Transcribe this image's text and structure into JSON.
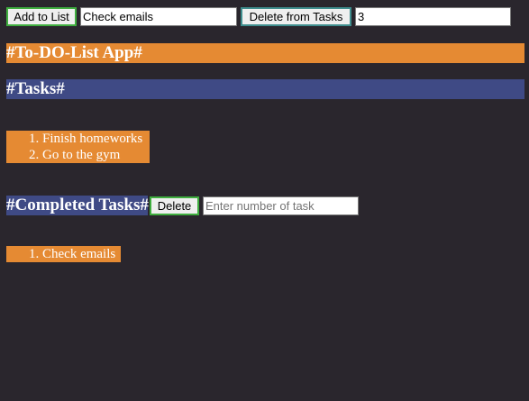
{
  "toolbar": {
    "add_button_label": "Add to List",
    "task_input_value": "Check emails",
    "delete_from_tasks_label": "Delete from Tasks",
    "delete_index_value": "3"
  },
  "app_title": "#To-DO-List App#",
  "tasks_section": {
    "title": "#Tasks#",
    "items": [
      "Finish homeworks",
      "Go to the gym"
    ]
  },
  "completed_section": {
    "title": "#Completed Tasks#",
    "delete_button_label": "Delete",
    "number_input_placeholder": "Enter number of task",
    "items": [
      "Check emails"
    ]
  },
  "colors": {
    "background": "#2a262d",
    "orange": "#e58a33",
    "navy": "#3f4a85",
    "button_border_green": "#3fae3f",
    "button_border_teal": "#3f8e8e"
  }
}
